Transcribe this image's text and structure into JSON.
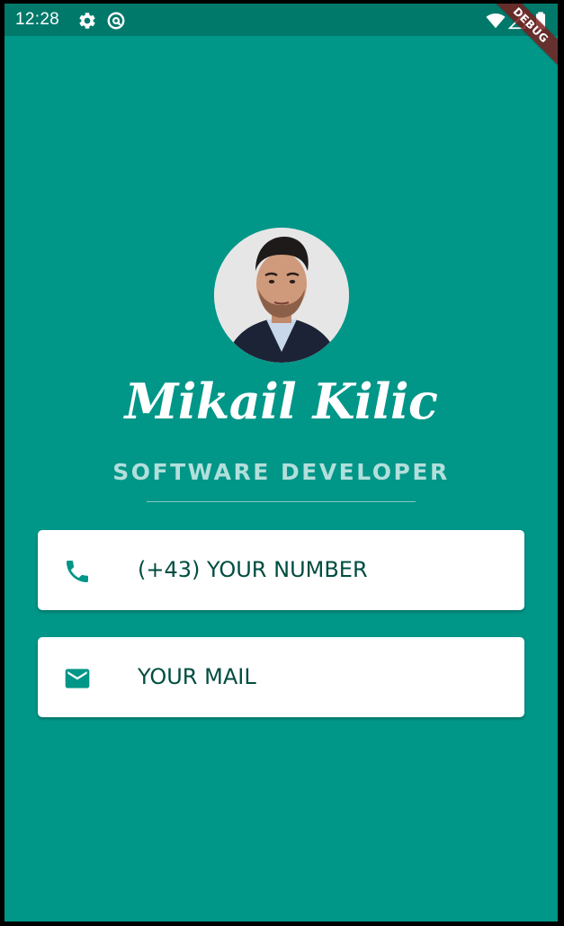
{
  "status_bar": {
    "time": "12:28",
    "left_icons": [
      "gear-icon",
      "at-sign-icon"
    ],
    "right_icons": [
      "wifi-icon",
      "signal-icon",
      "battery-icon"
    ]
  },
  "debug_banner": "DEBUG",
  "profile": {
    "name": "Mikail Kilic",
    "title": "SOFTWARE DEVELOPER"
  },
  "contacts": {
    "phone": {
      "icon": "phone-icon",
      "label": "(+43) YOUR NUMBER"
    },
    "mail": {
      "icon": "mail-icon",
      "label": "YOUR MAIL"
    }
  },
  "colors": {
    "background": "#009688",
    "status_bar": "#00796b",
    "card": "#ffffff",
    "card_text": "#004d40",
    "subtitle": "#b2dfdb"
  }
}
